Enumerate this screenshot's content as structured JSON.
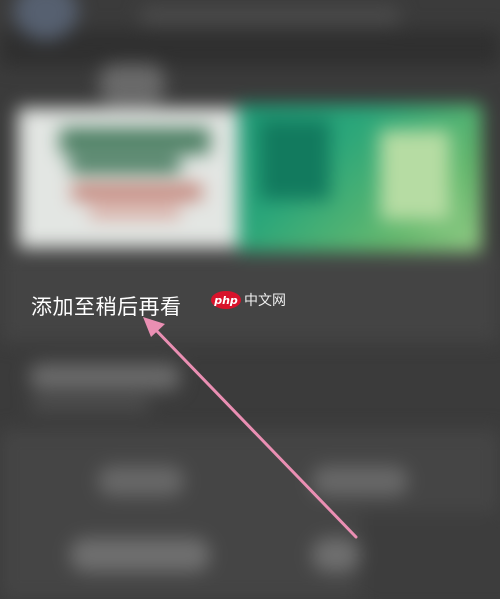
{
  "caption": {
    "text": "添加至稍后再看"
  },
  "watermark": {
    "logo_text": "php",
    "site_text": "中文网",
    "logo_color": "#d8132b"
  },
  "annotation": {
    "arrow_color": "#ea8fb3",
    "arrow_icon": "arrow-pointer-icon"
  }
}
